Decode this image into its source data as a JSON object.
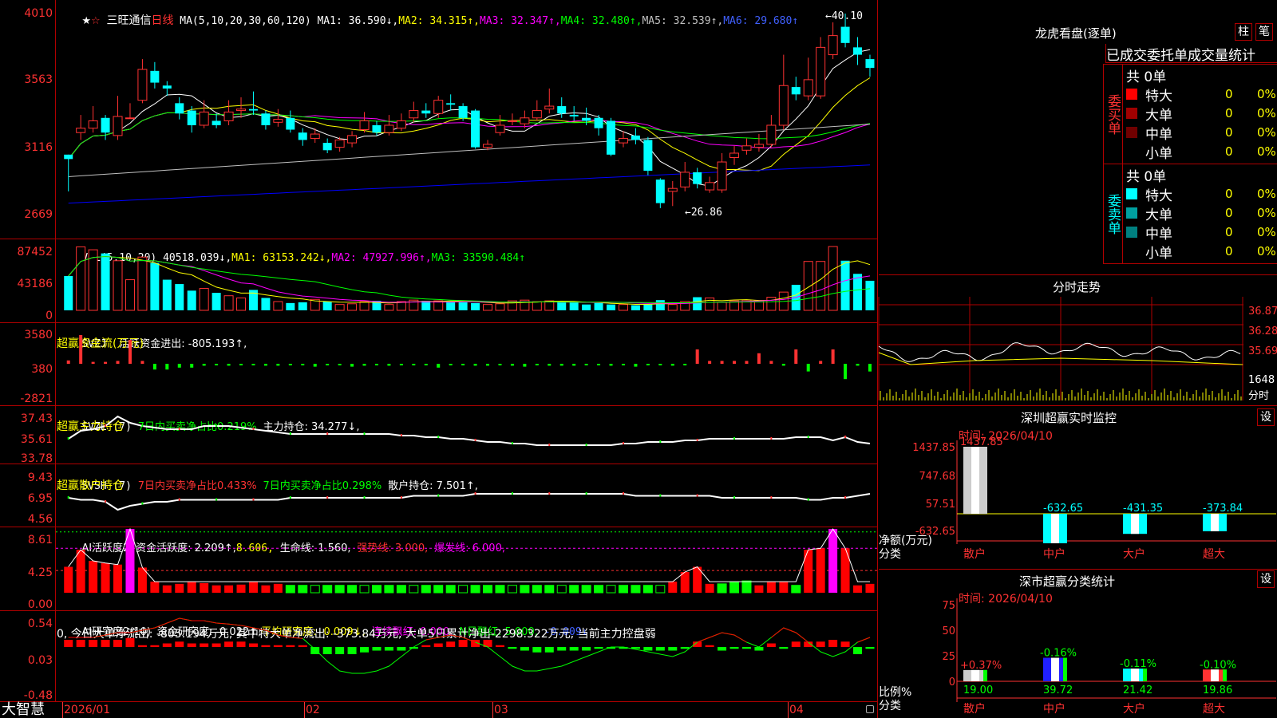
{
  "colors": {
    "up": "#ff3232",
    "down": "#00ffff",
    "frame": "#b00000",
    "ma1": "#ffffff",
    "ma2": "#ffff00",
    "ma3": "#ff00ff",
    "ma4": "#00ff00",
    "ma5": "#c0c0c0",
    "ma6": "#0000ff"
  },
  "header": {
    "star": "★",
    "tag": "☆",
    "name": "三旺通信",
    "period": "日线",
    "ma_label": "MA(5,10,20,30,60,120)",
    "ma1": "MA1: 36.590↓,",
    "ma2": "MA2: 34.315↑,",
    "ma3": "MA3: 32.347↑,",
    "ma4": "MA4: 32.480↑,",
    "ma5": "MA5: 32.539↑,",
    "ma6": "MA6: 29.680↑"
  },
  "price_axis": [
    "4010",
    "3563",
    "3116",
    "2669"
  ],
  "price_marks": {
    "high": "40.10",
    "low": "26.86"
  },
  "vol": {
    "label": "VOL(5,10,20)",
    "value": "40518.039↓,",
    "ma1": "MA1: 63153.242↓,",
    "ma2": "MA2: 47927.996↑,",
    "ma3": "MA3: 33590.484↑",
    "axis": [
      "87452",
      "43186",
      "0"
    ]
  },
  "svzj": {
    "label": "SVZJ",
    "title": "活跃资金进出: -805.193↑,",
    "sub": "超赢资金流(万元)",
    "axis": [
      "3580",
      "380",
      "-2821"
    ]
  },
  "svzl": {
    "label": "SVZL (7)",
    "a": "7日内买卖净占比0.219%",
    "b": "主力持仓: 34.277↓,",
    "sub": "超赢主力持仓",
    "axis": [
      "37.43",
      "35.61",
      "33.78"
    ]
  },
  "svsh": {
    "label": "SVSH (7)",
    "a": "7日内买卖净占比0.433%",
    "b": "7日内买卖净占比0.298%",
    "c": "散户持仓: 7.501↑,",
    "sub": "超赢散户持仓",
    "axis": [
      "9.43",
      "6.95",
      "4.56"
    ]
  },
  "ai1": {
    "label": "AI活跃度2",
    "a": "资金活跃度: 2.209↑,",
    "b": "8.606,",
    "c": "生命线: 1.560,",
    "d": "强势线: 3.000,",
    "e": "爆发线: 6.000,",
    "axis": [
      "8.61",
      "4.25",
      "0.00"
    ]
  },
  "ai2": {
    "label": "AI研究度2(10)",
    "a": "资金研究度: -0.022↑,",
    "b": "平均研究度: -0.009↓,",
    "c": "连续飘红: 0.000,",
    "d": "N日飘红: 5.000,",
    "e": "-0.009↓",
    "comment": "0, 今日大单净流出: -805.194万元, 其中特大单净流出: -373.84万元, 大单5日累计净出-2298.322万元, 当前主力控盘弱",
    "axis": [
      "0.54",
      "0.03",
      "-0.48"
    ]
  },
  "bottom": {
    "logo": "大智慧",
    "dates": [
      "2026/01",
      "02",
      "03",
      "04"
    ]
  },
  "longhu": {
    "title": "龙虎看盘(逐单)",
    "btn_bar": "柱",
    "btn_pen": "笔",
    "tabs": [
      "已成交",
      "委托单",
      "成交量统计"
    ],
    "buy": {
      "label": "委买单",
      "total": "共 0单",
      "rows": [
        {
          "name": "特大",
          "count": "0",
          "pct": "0%",
          "color": "#ff0000"
        },
        {
          "name": "大单",
          "count": "0",
          "pct": "0%",
          "color": "#a00000"
        },
        {
          "name": "中单",
          "count": "0",
          "pct": "0%",
          "color": "#700000"
        },
        {
          "name": "小单",
          "count": "0",
          "pct": "0%",
          "color": "#000000"
        }
      ]
    },
    "sell": {
      "label": "委卖单",
      "total": "共 0单",
      "rows": [
        {
          "name": "特大",
          "count": "0",
          "pct": "0%",
          "color": "#00ffff"
        },
        {
          "name": "大单",
          "count": "0",
          "pct": "0%",
          "color": "#00a0a0"
        },
        {
          "name": "中单",
          "count": "0",
          "pct": "0%",
          "color": "#008080"
        },
        {
          "name": "小单",
          "count": "0",
          "pct": "0%",
          "color": "#000000"
        }
      ]
    }
  },
  "intraday": {
    "title": "分时走势",
    "axis": [
      "36.87",
      "36.28",
      "35.69"
    ],
    "vol_axis": "1648",
    "vol_unit": "分时"
  },
  "sz_monitor": {
    "title": "深圳超赢实时监控",
    "btn": "设",
    "time": "时间: 2026/04/10",
    "axis": [
      "1437.85",
      "747.68",
      "57.51",
      "-632.65"
    ],
    "ylabel1": "净额(万元)",
    "ylabel2": "分类",
    "chart_data": {
      "type": "bar",
      "categories": [
        "散户",
        "中户",
        "大户",
        "超大"
      ],
      "values": [
        1437.85,
        -632.65,
        -431.35,
        -373.84
      ],
      "labels": [
        "1437.85",
        "-632.65",
        "-431.35",
        "-373.84"
      ]
    }
  },
  "sz_class": {
    "title": "深市超赢分类统计",
    "btn": "设",
    "time": "时间: 2026/04/10",
    "axis": [
      "75",
      "50",
      "25",
      "0"
    ],
    "ylabel1": "比例%",
    "ylabel2": "分类",
    "chart_data": {
      "type": "bar",
      "categories": [
        "散户",
        "中户",
        "大户",
        "超大"
      ],
      "values": [
        19.0,
        39.72,
        21.42,
        19.86
      ],
      "changes": [
        "+0.37%",
        "-0.16%",
        "-0.11%",
        "-0.10%"
      ],
      "labels": [
        "19.00",
        "39.72",
        "21.42",
        "19.86"
      ],
      "ylim": [
        0,
        75
      ]
    }
  },
  "chart_data": {
    "type": "candlestick",
    "ylim": [
      26.69,
      40.1
    ],
    "high": 40.1,
    "low": 26.86,
    "candles": [
      [
        30.5,
        30.2,
        29.0,
        28.0
      ],
      [
        32.0,
        32.3,
        33.2,
        31.5
      ],
      [
        32.3,
        32.8,
        33.8,
        32.0
      ],
      [
        33.0,
        32.0,
        31.5,
        33.2
      ],
      [
        31.8,
        33.1,
        34.5,
        31.5
      ],
      [
        33.0,
        33.0,
        34.0,
        33.0
      ],
      [
        34.2,
        36.3,
        37.0,
        34.0
      ],
      [
        36.2,
        35.4,
        36.8,
        35.0
      ],
      [
        35.2,
        35.0,
        35.5,
        34.5
      ],
      [
        34.0,
        33.3,
        34.4,
        32.9
      ],
      [
        33.5,
        32.5,
        32.0,
        33.8
      ],
      [
        32.5,
        33.4,
        34.2,
        32.3
      ],
      [
        32.8,
        32.5,
        33.3,
        32.3
      ],
      [
        32.8,
        33.4,
        34.2,
        32.5
      ],
      [
        33.5,
        33.6,
        34.4,
        33.0
      ],
      [
        33.6,
        33.5,
        34.8,
        33.2
      ],
      [
        33.3,
        32.5,
        33.5,
        32.2
      ],
      [
        32.7,
        32.9,
        33.6,
        32.4
      ],
      [
        33.0,
        32.2,
        32.0,
        33.5
      ],
      [
        32.0,
        31.5,
        31.1,
        32.3
      ],
      [
        31.6,
        31.9,
        32.3,
        31.3
      ],
      [
        31.3,
        30.8,
        30.6,
        31.6
      ],
      [
        31.0,
        31.5,
        31.7,
        30.7
      ],
      [
        31.3,
        31.8,
        32.1,
        31.0
      ],
      [
        32.2,
        32.8,
        33.4,
        32.0
      ],
      [
        32.5,
        32.0,
        32.8,
        31.8
      ],
      [
        32.0,
        32.5,
        33.2,
        31.8
      ],
      [
        32.3,
        32.8,
        33.3,
        32.1
      ],
      [
        33.0,
        33.5,
        34.1,
        32.7
      ],
      [
        33.5,
        33.3,
        34.0,
        33.0
      ],
      [
        33.3,
        34.2,
        34.5,
        33.0
      ],
      [
        34.0,
        33.9,
        34.6,
        33.5
      ],
      [
        33.8,
        33.0,
        34.0,
        32.8
      ],
      [
        33.5,
        31.0,
        30.9,
        33.6
      ],
      [
        31.0,
        31.2,
        31.5,
        30.8
      ],
      [
        32.0,
        32.5,
        33.2,
        31.8
      ],
      [
        32.8,
        32.8,
        33.3,
        32.5
      ],
      [
        32.6,
        33.0,
        33.5,
        32.3
      ],
      [
        33.0,
        33.5,
        34.2,
        32.8
      ],
      [
        33.6,
        33.8,
        35.0,
        33.3
      ],
      [
        33.8,
        33.3,
        34.4,
        33.0
      ],
      [
        33.2,
        33.1,
        33.8,
        32.8
      ],
      [
        33.0,
        32.8,
        33.7,
        32.5
      ],
      [
        33.0,
        32.3,
        33.2,
        31.8
      ],
      [
        32.8,
        30.5,
        30.4,
        33.0
      ],
      [
        31.3,
        31.6,
        32.1,
        31.0
      ],
      [
        31.8,
        31.5,
        32.3,
        31.2
      ],
      [
        31.5,
        29.4,
        29.1,
        31.7
      ],
      [
        28.8,
        27.2,
        26.86,
        28.9
      ],
      [
        28.0,
        28.2,
        28.7,
        27.0
      ],
      [
        28.3,
        29.3,
        30.0,
        28.0
      ],
      [
        29.3,
        28.5,
        28.2,
        29.6
      ],
      [
        28.1,
        28.6,
        29.0,
        27.9
      ],
      [
        28.1,
        30.0,
        30.6,
        27.9
      ],
      [
        30.3,
        30.6,
        31.1,
        29.8
      ],
      [
        30.8,
        31.1,
        31.6,
        30.5
      ],
      [
        31.0,
        31.2,
        31.9,
        30.7
      ],
      [
        31.2,
        32.5,
        33.2,
        31.0
      ],
      [
        32.5,
        35.2,
        37.3,
        32.2
      ],
      [
        35.1,
        34.6,
        35.8,
        34.2
      ],
      [
        34.5,
        35.6,
        37.1,
        34.2
      ],
      [
        34.5,
        37.8,
        38.5,
        34.3
      ],
      [
        37.3,
        38.6,
        39.5,
        37.0
      ],
      [
        39.2,
        38.1,
        40.1,
        37.8
      ],
      [
        37.8,
        37.3,
        38.5,
        36.6
      ],
      [
        37.0,
        36.4,
        37.3,
        35.8
      ]
    ]
  },
  "volume": [
    47000,
    87000,
    83000,
    78000,
    68000,
    42000,
    73000,
    65000,
    42000,
    36000,
    27000,
    30000,
    24000,
    20000,
    17000,
    28000,
    17000,
    12000,
    10000,
    11000,
    15000,
    12000,
    8000,
    9000,
    12000,
    13000,
    8000,
    12000,
    14000,
    13000,
    13000,
    12000,
    11000,
    10000,
    8000,
    9000,
    13000,
    14000,
    12000,
    13000,
    11000,
    11000,
    8000,
    10000,
    8000,
    8000,
    7000,
    8000,
    14000,
    8000,
    12000,
    18000,
    17000,
    11000,
    13000,
    14000,
    13000,
    18000,
    25000,
    35000,
    67000,
    67000,
    87452,
    68000,
    50000,
    40518
  ],
  "svzj_bars": [
    350,
    3000,
    200,
    200,
    300,
    2500,
    300,
    -600,
    -600,
    -400,
    -400,
    -200,
    -100,
    -200,
    -100,
    -100,
    -200,
    -200,
    -100,
    -100,
    -300,
    -100,
    -100,
    -300,
    -200,
    -100,
    -200,
    -100,
    -100,
    -100,
    -400,
    -100,
    -100,
    -200,
    -200,
    -100,
    -200,
    -300,
    -100,
    -200,
    -200,
    -200,
    -100,
    -100,
    -200,
    -100,
    -300,
    -100,
    -100,
    -200,
    -100,
    1500,
    300,
    300,
    300,
    300,
    1100,
    300,
    -200,
    1500,
    -800,
    300,
    1500,
    -1600,
    -200,
    -805
  ]
}
